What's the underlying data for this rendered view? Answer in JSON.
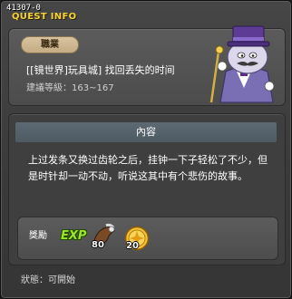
{
  "window": {
    "quest_id": "41307-0",
    "title": "QUEST INFO"
  },
  "quest": {
    "job_badge": "職業",
    "name": "[[镜世界]玩具城] 找回丢失的时间",
    "level_label": "建議等級：",
    "level_range": "163~167"
  },
  "content": {
    "header": "內容",
    "description": "上过发条又换过齿轮之后，挂钟一下子轻松了不少，但是时针却一动不动，听说这其中有个悲伤的故事。"
  },
  "rewards": {
    "label": "獎勵",
    "exp_label": "EXP",
    "item_count": "80",
    "mesos_count": "20"
  },
  "status": {
    "label": "狀態：",
    "value": "可開始"
  },
  "icons": {
    "npc": "gentleman-npc-portrait",
    "item": "horn-item-icon",
    "coin": "gold-coin-icon",
    "exp": "exp-icon"
  },
  "colors": {
    "title": "#f5d23a",
    "badge": "#d8c3a0",
    "content_header": "#56626b",
    "exp": "#9be42a"
  }
}
